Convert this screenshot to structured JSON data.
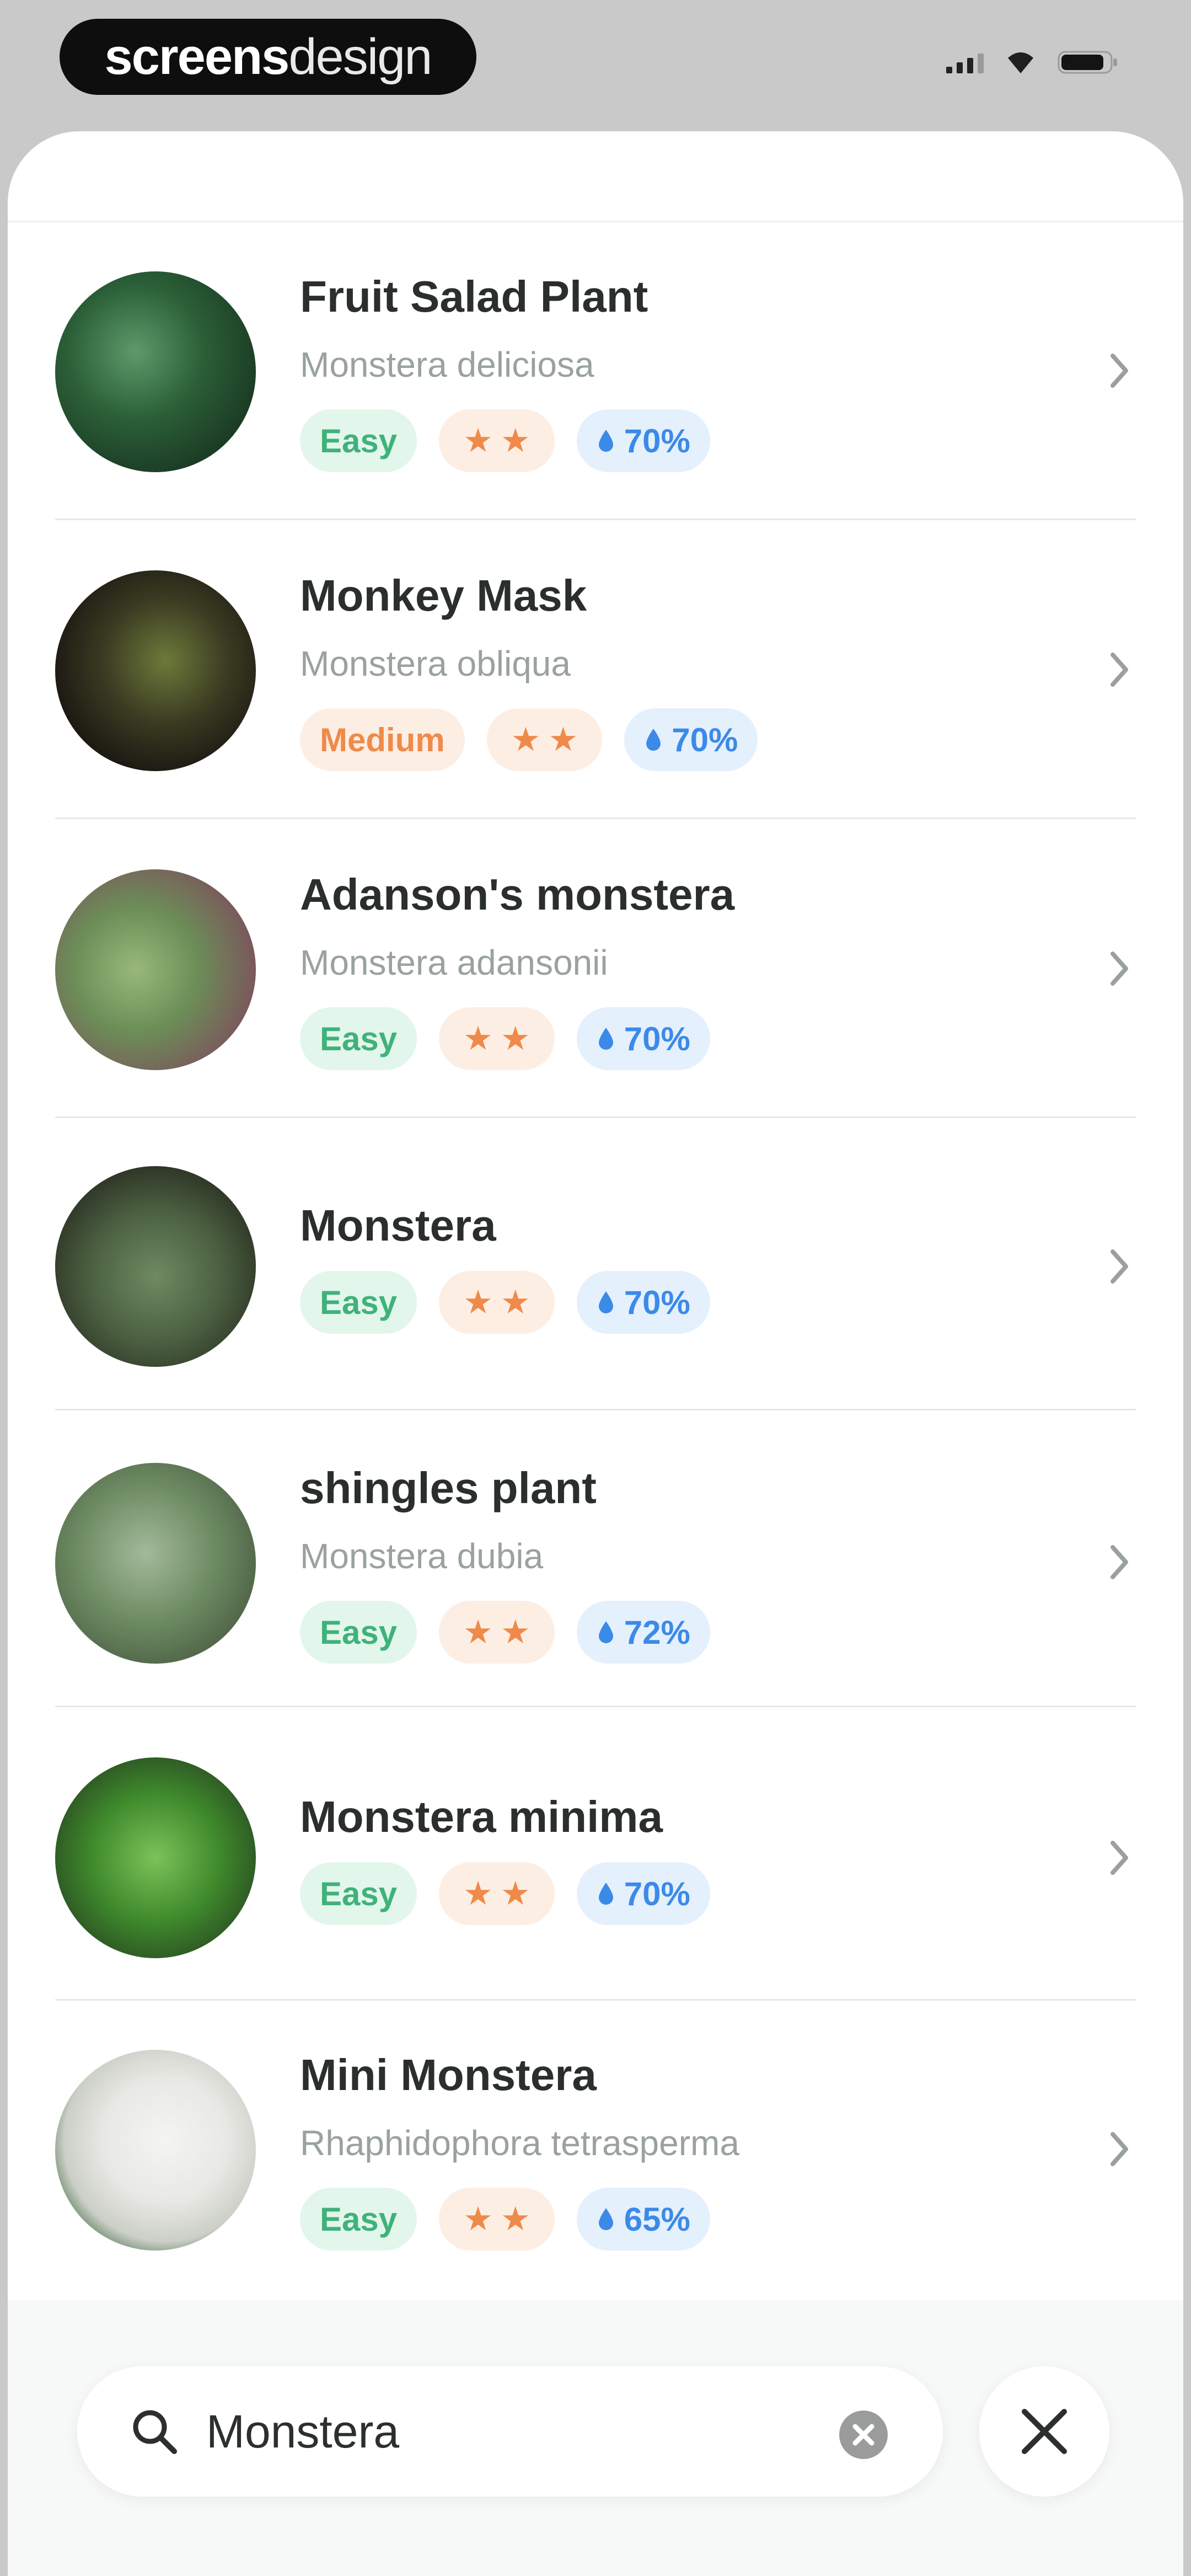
{
  "status_bar": {
    "logo_bold": "screens",
    "logo_light": "design"
  },
  "plants": [
    {
      "name": "Fruit Salad Plant",
      "scientific": "Monstera deliciosa",
      "difficulty": "Easy",
      "stars": "★★",
      "humidity": "70%"
    },
    {
      "name": "Monkey Mask",
      "scientific": "Monstera obliqua",
      "difficulty": "Medium",
      "stars": "★★",
      "humidity": "70%"
    },
    {
      "name": "Adanson's monstera",
      "scientific": "Monstera adansonii",
      "difficulty": "Easy",
      "stars": "★★",
      "humidity": "70%"
    },
    {
      "name": "Monstera",
      "scientific": "",
      "difficulty": "Easy",
      "stars": "★★",
      "humidity": "70%"
    },
    {
      "name": "shingles plant",
      "scientific": "Monstera dubia",
      "difficulty": "Easy",
      "stars": "★★",
      "humidity": "72%"
    },
    {
      "name": "Monstera minima",
      "scientific": "",
      "difficulty": "Easy",
      "stars": "★★",
      "humidity": "70%"
    },
    {
      "name": "Mini Monstera",
      "scientific": "Rhaphidophora tetrasperma",
      "difficulty": "Easy",
      "stars": "★★",
      "humidity": "65%"
    }
  ],
  "search": {
    "query": "Monstera"
  },
  "colors": {
    "easy_bg": "#e3f6ec",
    "easy_text": "#3fb27a",
    "orange_bg": "#fdeee4",
    "orange_text": "#ef8a4a",
    "water_bg": "#e5f0fd",
    "water_text": "#3c8ae8"
  },
  "icons": {
    "search": "search-icon",
    "clear": "clear-icon",
    "close": "close-icon",
    "chevron": "chevron-right-icon",
    "drop": "water-drop-icon"
  }
}
